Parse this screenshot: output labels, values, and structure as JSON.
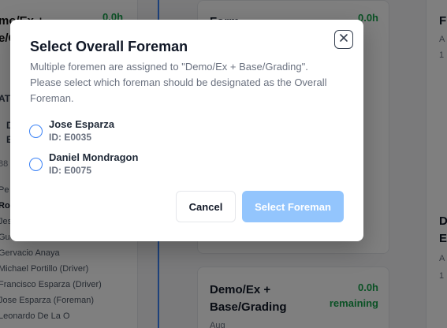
{
  "background": {
    "left_column": {
      "title": "mo/Ex +\ne/Gra",
      "hours": "0.0h",
      "labels": [
        "AT",
        "D",
        "E",
        "88",
        "Pe"
      ],
      "crew": [
        "Ro",
        "Jes",
        "Gu",
        "Gervacio Anaya",
        "Michael Portillo (Driver)",
        "Francisco Esparza (Driver)",
        "Jose Esparza (Foreman)",
        "Leonardo De La O"
      ]
    },
    "middle_column": {
      "top_card_title": "Form",
      "top_card_hours": "0.0h",
      "bottom_card_title": "Demo/Ex +\nBase/Grading",
      "bottom_card_hours": "0.0h",
      "bottom_card_remaining": "remaining",
      "bottom_card_sub": "Aug"
    },
    "right_column": {
      "snippets": [
        "F",
        "A",
        "1",
        "D",
        "E",
        "A",
        "1"
      ]
    }
  },
  "modal": {
    "title": "Select Overall Foreman",
    "description": "Multiple foremen are assigned to \"Demo/Ex + Base/Grading\". Please select which foreman should be designated as the Overall Foreman.",
    "close_icon": "close-icon",
    "options": [
      {
        "name": "Jose Esparza",
        "id": "ID: E0035"
      },
      {
        "name": "Daniel Mondragon",
        "id": "ID: E0075"
      }
    ],
    "cancel_label": "Cancel",
    "select_label": "Select Foreman"
  }
}
